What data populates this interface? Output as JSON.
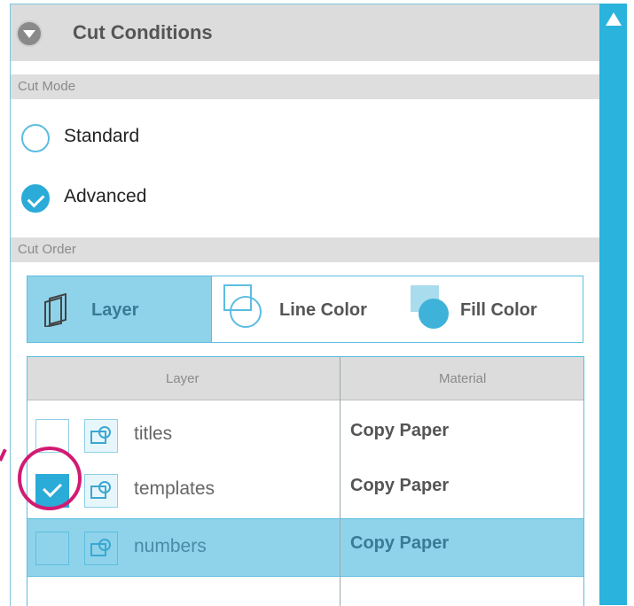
{
  "header": {
    "title": "Cut Conditions",
    "toggle_icon": "chevron-down-circle-icon"
  },
  "cut_mode": {
    "section_label": "Cut Mode",
    "options": [
      {
        "label": "Standard",
        "checked": false
      },
      {
        "label": "Advanced",
        "checked": true
      }
    ]
  },
  "cut_order": {
    "section_label": "Cut Order",
    "buttons": [
      {
        "label": "Layer",
        "active": true,
        "icon": "layers-icon"
      },
      {
        "label": "Line Color",
        "active": false,
        "icon": "line-color-icon"
      },
      {
        "label": "Fill Color",
        "active": false,
        "icon": "fill-color-icon"
      }
    ]
  },
  "table": {
    "headers": {
      "layer": "Layer",
      "material": "Material"
    },
    "rows": [
      {
        "layer": "titles",
        "material": "Copy Paper",
        "checked": false,
        "selected": false
      },
      {
        "layer": "templates",
        "material": "Copy Paper",
        "checked": true,
        "selected": false
      },
      {
        "layer": "numbers",
        "material": "Copy Paper",
        "checked": false,
        "selected": true
      }
    ]
  },
  "colors": {
    "accent": "#29b3dd",
    "highlight_selected": "#8fd3ea",
    "annotation": "#d31a72"
  }
}
